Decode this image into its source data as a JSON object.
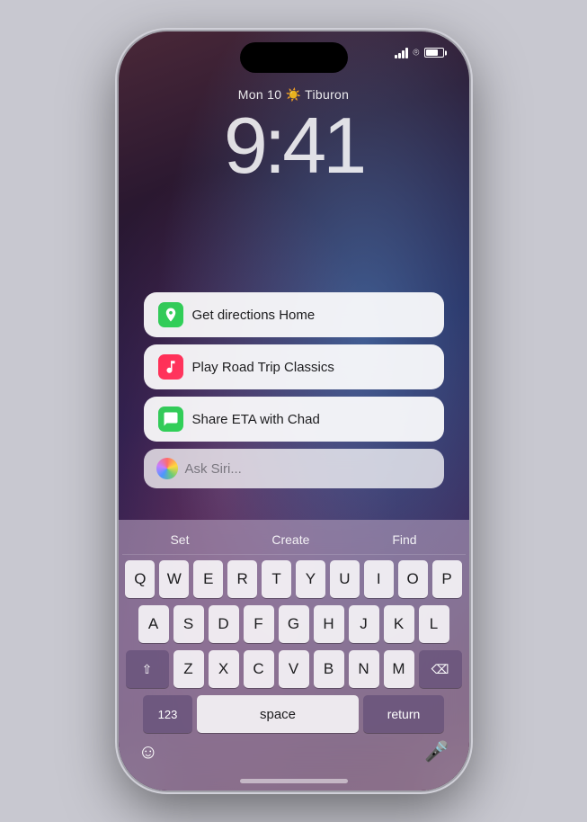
{
  "phone": {
    "status": {
      "date": "Mon 10",
      "weather_icon": "☀️",
      "location": "Tiburon",
      "time": "9:41"
    },
    "suggestions": [
      {
        "id": "directions",
        "icon_type": "maps",
        "icon_emoji": "🗺",
        "text": "Get directions Home"
      },
      {
        "id": "music",
        "icon_type": "music",
        "icon_emoji": "♪",
        "text": "Play Road Trip Classics"
      },
      {
        "id": "messages",
        "icon_type": "messages",
        "icon_emoji": "💬",
        "text": "Share ETA with Chad"
      }
    ],
    "siri": {
      "placeholder": "Ask Siri..."
    },
    "keyboard": {
      "suggestions": [
        "Set",
        "Create",
        "Find"
      ],
      "rows": [
        [
          "Q",
          "W",
          "E",
          "R",
          "T",
          "Y",
          "U",
          "I",
          "O",
          "P"
        ],
        [
          "A",
          "S",
          "D",
          "F",
          "G",
          "H",
          "J",
          "K",
          "L"
        ],
        [
          "⇧",
          "Z",
          "X",
          "C",
          "V",
          "B",
          "N",
          "M",
          "⌫"
        ],
        [
          "123",
          "space",
          "return"
        ]
      ]
    }
  }
}
